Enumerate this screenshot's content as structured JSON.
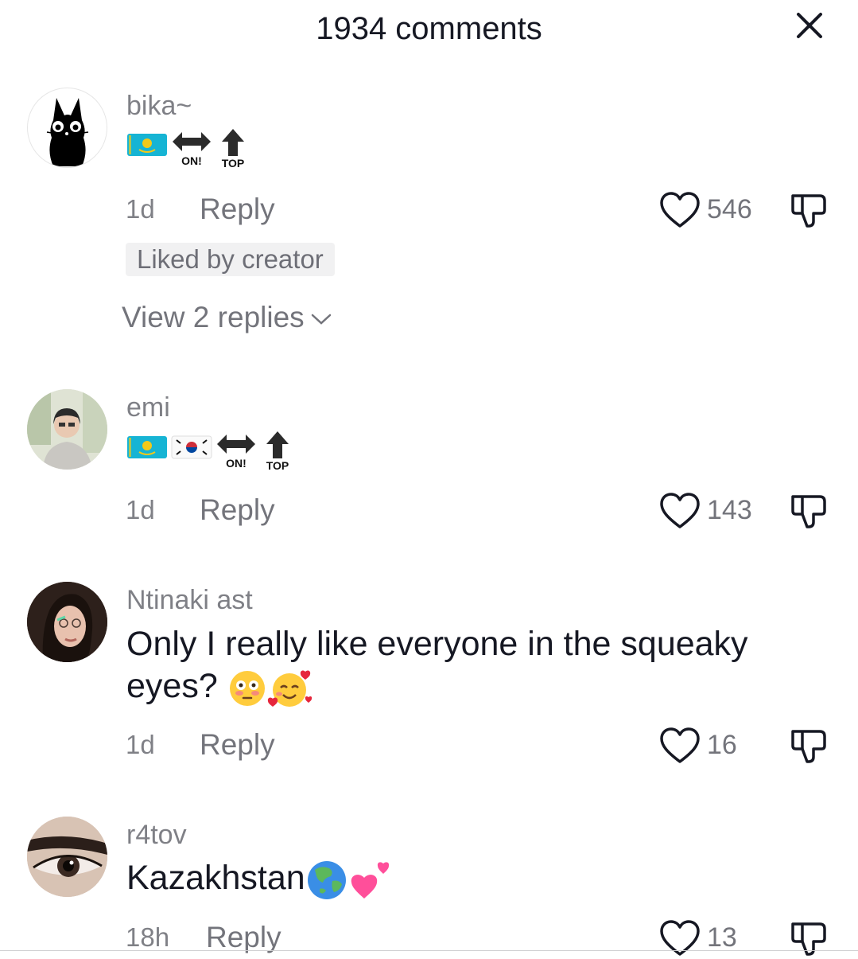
{
  "header": {
    "title": "1934 comments"
  },
  "icons": {
    "close": "close-icon",
    "like": "heart-outline-icon",
    "dislike": "thumbs-down-icon",
    "expand": "chevron-down-icon"
  },
  "colors": {
    "text": "#161823",
    "secondary": "#8a8b91",
    "badge_bg": "#f1f1f2"
  },
  "comments": [
    {
      "username": "bika~",
      "badges": [
        "kazakhstan-flag",
        "left-right-arrow",
        "top-arrow"
      ],
      "badge_labels": [
        "ON!",
        "TOP"
      ],
      "time": "1d",
      "reply_label": "Reply",
      "likes": "546",
      "liked_by_creator": "Liked by creator",
      "view_replies": "View 2 replies"
    },
    {
      "username": "emi",
      "badges": [
        "kazakhstan-flag",
        "south-korea-flag",
        "left-right-arrow",
        "top-arrow"
      ],
      "badge_labels": [
        "ON!",
        "TOP"
      ],
      "time": "1d",
      "reply_label": "Reply",
      "likes": "143"
    },
    {
      "username": "Ntinaki ast",
      "text": "Only I really like everyone in the squeaky eyes? ",
      "emojis": [
        "flushed-face",
        "smiling-face-with-hearts"
      ],
      "time": "1d",
      "reply_label": "Reply",
      "likes": "16"
    },
    {
      "username": "r4tov",
      "text": "Kazakhstan",
      "emojis": [
        "globe-asia",
        "two-hearts"
      ],
      "time": "18h",
      "reply_label": "Reply",
      "likes": "13"
    }
  ]
}
